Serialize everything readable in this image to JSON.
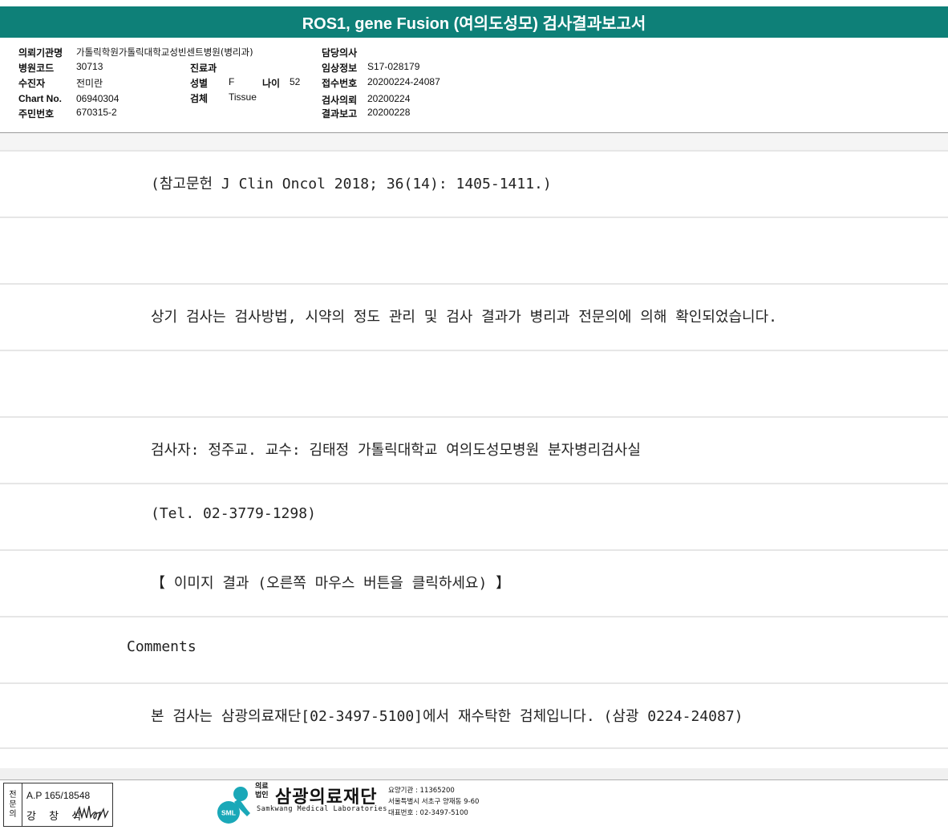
{
  "title": "ROS1, gene Fusion (여의도성모) 검사결과보고서",
  "header": {
    "institution_label": "의뢰기관명",
    "institution_value": "가톨릭학원가톨릭대학교성빈센트병원(병리과)",
    "hospital_code_label": "병원코드",
    "hospital_code_value": "30713",
    "patient_label": "수진자",
    "patient_value": "전미란",
    "chart_label": "Chart No.",
    "chart_value": "06940304",
    "resident_label": "주민번호",
    "resident_value": "670315-2",
    "dept_label": "진료과",
    "dept_value": "",
    "sex_label": "성별",
    "sex_value": "F",
    "age_label": "나이",
    "age_value": "52",
    "specimen_label": "검체",
    "specimen_value": "Tissue",
    "doctor_label": "담당의사",
    "doctor_value": "",
    "clinical_label": "임상정보",
    "clinical_value": "S17-028179",
    "receipt_label": "접수번호",
    "receipt_value": "20200224-24087",
    "request_label": "검사의뢰",
    "request_value": "20200224",
    "report_label": "결과보고",
    "report_value": "20200228"
  },
  "rows": [
    "(참고문헌 J Clin Oncol 2018; 36(14): 1405-1411.)",
    "",
    "상기 검사는 검사방법, 시약의 정도 관리 및 검사 결과가 병리과 전문의에 의해 확인되었습니다.",
    "",
    "검사자: 정주교. 교수: 김태정 가톨릭대학교 여의도성모병원 분자병리검사실",
    "(Tel. 02-3779-1298)",
    "【 이미지 결과 (오른쪽 마우스 버튼을 클릭하세요) 】",
    "Comments",
    "본 검사는 삼광의료재단[02-3497-5100]에서 재수탁한 검체입니다. (삼광 0224-24087)"
  ],
  "footer": {
    "stamp_side": [
      "전",
      "문",
      "의"
    ],
    "stamp_code": "A.P 165/18548",
    "stamp_name": "강 창 석",
    "logo_small_1": "의료",
    "logo_small_2": "법인",
    "logo_name": "삼광의료재단",
    "logo_english": "Samkwang Medical Laboratories",
    "logo_mark": "SML",
    "info_1": "요양기관 : 11365200",
    "info_2": "서울특별시 서초구 양재동 9-60",
    "info_3": "대표번호 : 02-3497-5100"
  },
  "colors": {
    "title_bar": "#0e8078",
    "logo": "#1aa8b8"
  }
}
